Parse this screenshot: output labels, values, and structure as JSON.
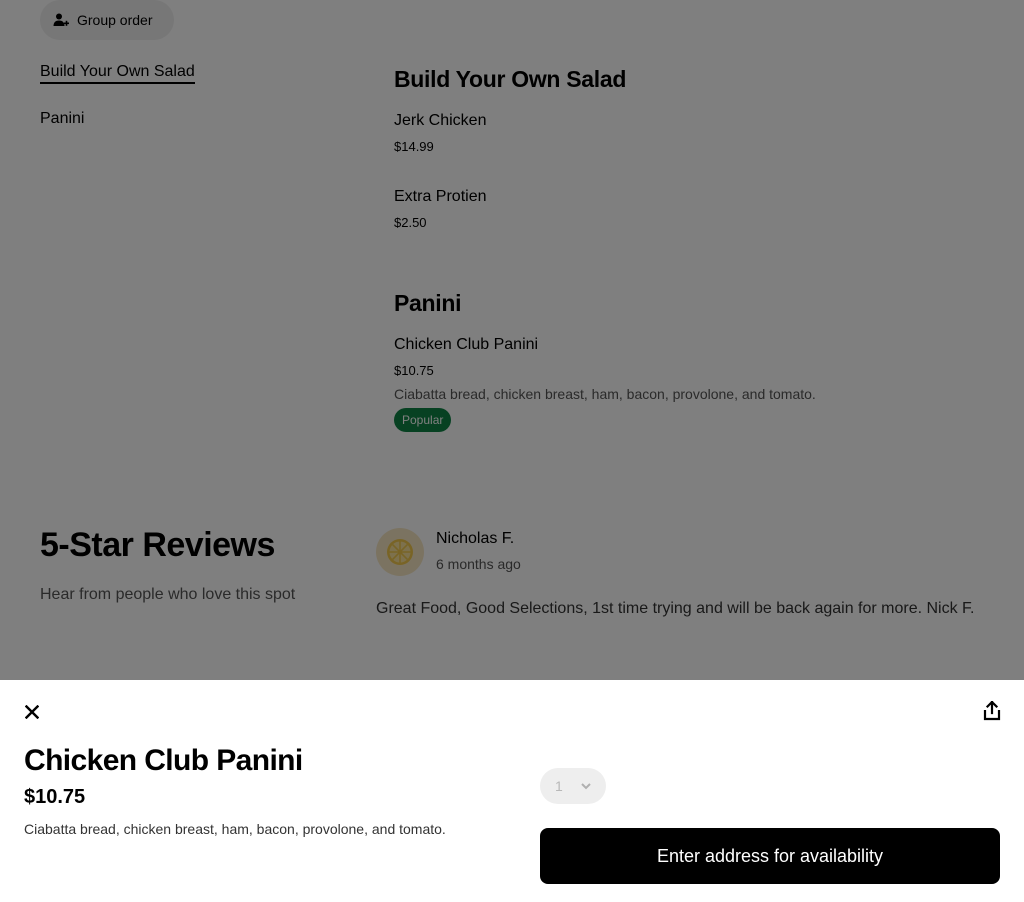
{
  "background": {
    "group_order_label": "Group order",
    "sidebar": {
      "items": [
        {
          "label": "Build Your Own Salad",
          "active": true
        },
        {
          "label": "Panini",
          "active": false
        }
      ]
    },
    "sections": [
      {
        "title": "Build Your Own Salad",
        "items": [
          {
            "name": "Jerk Chicken",
            "price": "$14.99"
          },
          {
            "name": "Extra Protien",
            "price": "$2.50"
          }
        ]
      },
      {
        "title": "Panini",
        "items": [
          {
            "name": "Chicken Club Panini",
            "price": "$10.75",
            "description": "Ciabatta bread, chicken breast, ham, bacon, provolone, and tomato.",
            "badge": "Popular"
          }
        ]
      }
    ],
    "reviews": {
      "title": "5-Star Reviews",
      "subtitle": "Hear from people who love this spot",
      "items": [
        {
          "name": "Nicholas F.",
          "date": "6 months ago",
          "text": "Great Food, Good Selections, 1st time trying and will be back again for more. Nick F."
        }
      ]
    }
  },
  "item_sheet": {
    "title": "Chicken Club Panini",
    "price": "$10.75",
    "description": "Ciabatta bread, chicken breast, ham, bacon, provolone, and tomato.",
    "quantity": "1",
    "cta_label": "Enter address for availability",
    "icons": {
      "close": "close-icon",
      "share": "share-icon",
      "chevron": "chevron-down-icon"
    }
  },
  "colors": {
    "popular_badge": "#0e8345",
    "cta_background": "#000000",
    "overlay": "rgba(0,0,0,0.5)"
  }
}
